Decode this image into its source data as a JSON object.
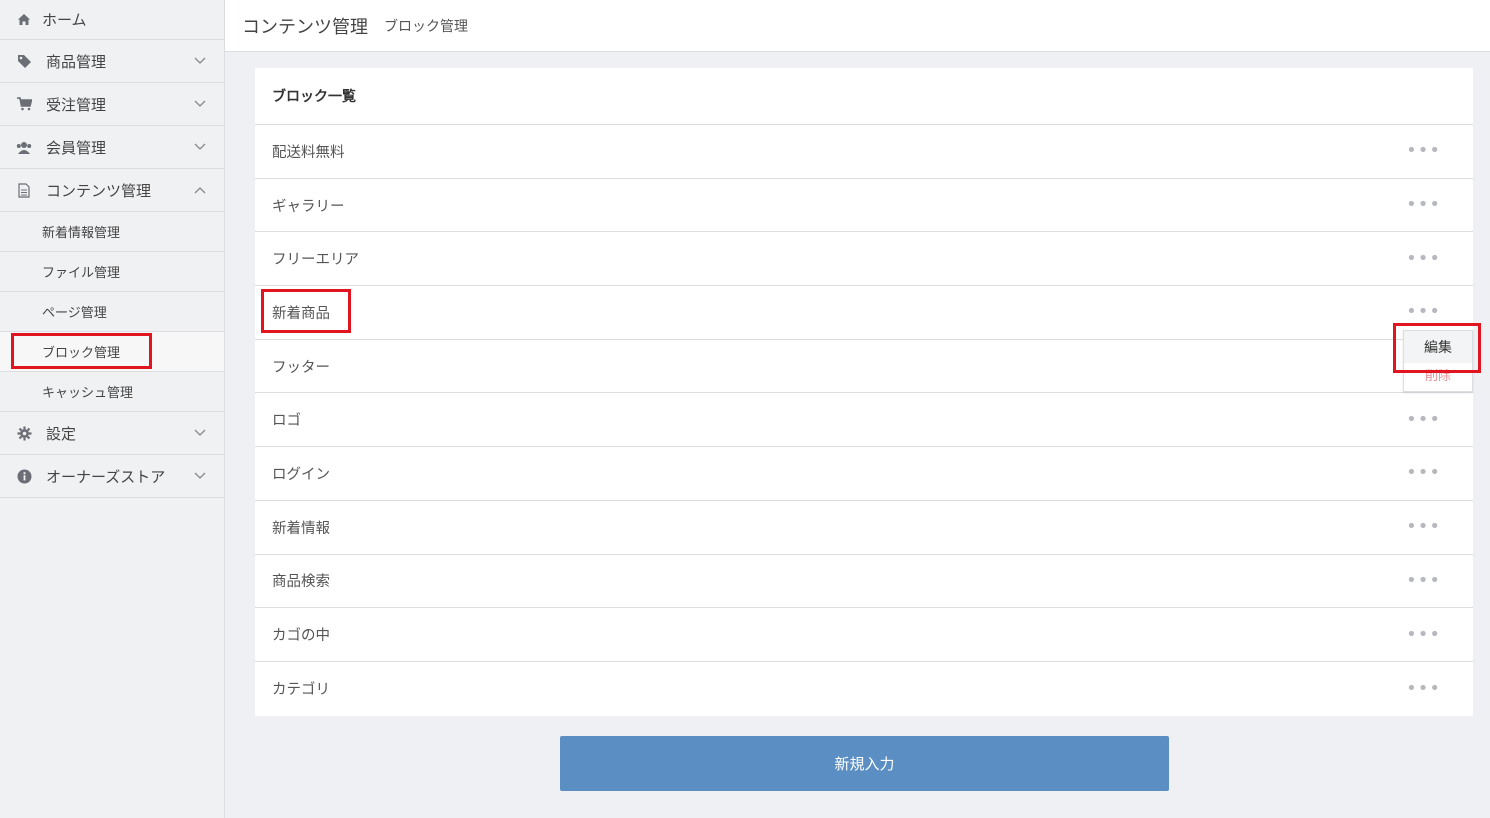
{
  "sidebar": {
    "home": "ホーム",
    "items": [
      {
        "label": "商品管理",
        "icon": "tag-icon"
      },
      {
        "label": "受注管理",
        "icon": "cart-icon"
      },
      {
        "label": "会員管理",
        "icon": "users-icon"
      },
      {
        "label": "コンテンツ管理",
        "icon": "file-icon"
      }
    ],
    "content_sub": [
      "新着情報管理",
      "ファイル管理",
      "ページ管理",
      "ブロック管理",
      "キャッシュ管理"
    ],
    "settings": "設定",
    "owners_store": "オーナーズストア"
  },
  "header": {
    "title": "コンテンツ管理",
    "subtitle": "ブロック管理"
  },
  "block_list": {
    "title": "ブロック一覧",
    "rows": [
      "配送料無料",
      "ギャラリー",
      "フリーエリア",
      "新着商品",
      "フッター",
      "ロゴ",
      "ログイン",
      "新着情報",
      "商品検索",
      "カゴの中",
      "カテゴリ"
    ],
    "row_menu_label": "•••"
  },
  "dropdown": {
    "edit": "編集",
    "delete": "削除"
  },
  "new_button": "新規入力",
  "colors": {
    "highlight": "#e0151f",
    "primary_button": "#5b8ec2"
  }
}
